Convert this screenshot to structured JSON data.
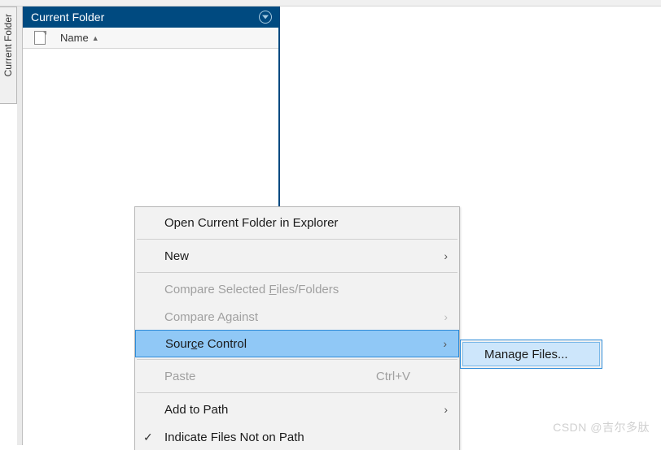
{
  "side_tab": {
    "label": "Current Folder"
  },
  "panel": {
    "title": "Current Folder",
    "column_header": "Name"
  },
  "context_menu": {
    "open_explorer": "Open Current Folder in Explorer",
    "new": "New",
    "compare_selected_pre": "Compare Selected ",
    "compare_selected_key": "F",
    "compare_selected_post": "iles/Folders",
    "compare_against": "Compare Against",
    "source_control_pre": "Sour",
    "source_control_key": "c",
    "source_control_post": "e Control",
    "paste": "Paste",
    "paste_shortcut": "Ctrl+V",
    "add_to_path": "Add to Path",
    "indicate": "Indicate Files Not on Path"
  },
  "submenu": {
    "manage_files": "Manage Files..."
  },
  "watermark": "CSDN @吉尔多肽"
}
